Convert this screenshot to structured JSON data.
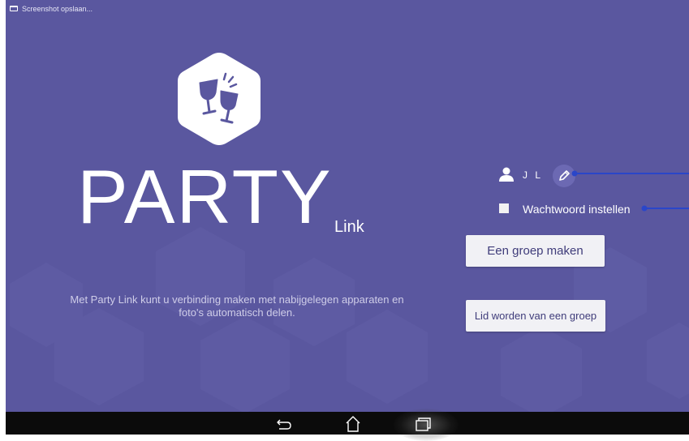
{
  "status_bar": {
    "notification_icon": "screenshot-icon",
    "notification_text": "Screenshot opslaan..."
  },
  "logo": {
    "icon": "toasting-glasses-icon"
  },
  "title": {
    "main": "PARTY",
    "sub": "Link"
  },
  "description": "Met Party Link kunt u verbinding maken met nabijgelegen apparaten en foto's automatisch delen.",
  "user": {
    "icon": "person-icon",
    "name": "J L",
    "edit_icon": "pencil-icon"
  },
  "password": {
    "label": "Wachtwoord instellen",
    "checked": false
  },
  "buttons": {
    "create_group": "Een groep maken",
    "join_group": "Lid worden van een groep"
  },
  "navigation": {
    "back_icon": "back-icon",
    "home_icon": "home-icon",
    "recents_icon": "recent-apps-icon"
  },
  "colors": {
    "background": "#5a579f",
    "accent": "#2a46c9",
    "button_text": "#3f3c7a",
    "logo_glyph": "#5a579f"
  }
}
